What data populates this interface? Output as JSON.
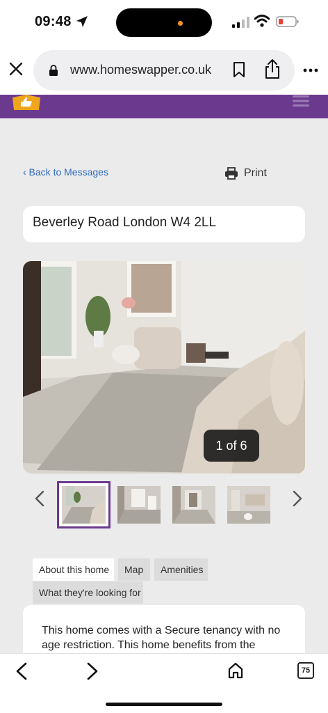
{
  "status_bar": {
    "time": "09:48"
  },
  "browser": {
    "url": "www.homeswapper.co.uk",
    "tab_count": "75",
    "icons": [
      "close-icon",
      "lock-icon",
      "bookmark-icon",
      "share-icon",
      "more-icon",
      "back-icon",
      "forward-icon",
      "home-icon",
      "tabs-icon"
    ]
  },
  "site": {
    "brand_color": "#6b3a8e",
    "logo_color": "#f0a51c"
  },
  "page": {
    "back_link": "‹ Back to Messages",
    "print_label": "Print",
    "address": "Beverley Road London W4 2LL",
    "photo_counter": "1 of 6",
    "tabs": [
      {
        "label": "About this home",
        "active": true
      },
      {
        "label": "Map",
        "active": false
      },
      {
        "label": "Amenities",
        "active": false
      },
      {
        "label": "What they're looking for",
        "active": false
      }
    ],
    "description": "This home comes with a Secure tenancy with no age restriction. This home benefits from the"
  }
}
